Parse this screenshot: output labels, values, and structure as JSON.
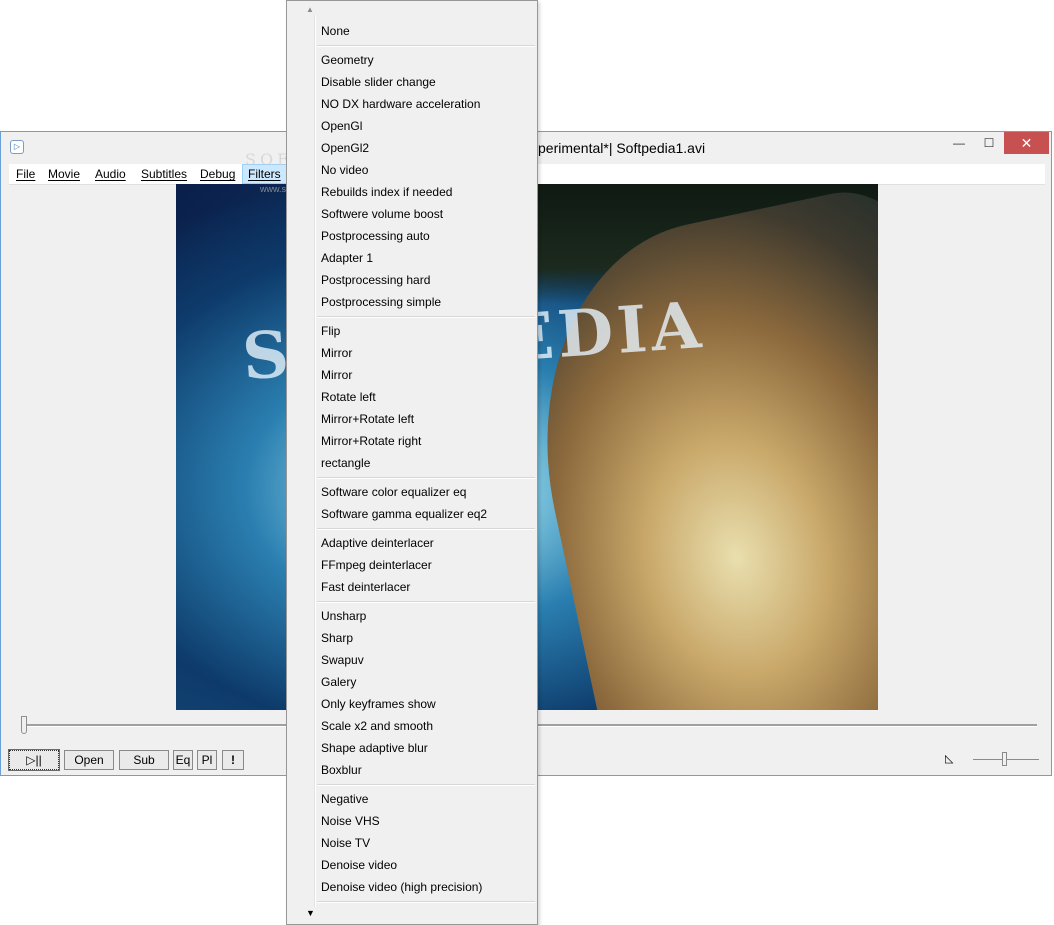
{
  "window": {
    "title": "perimental*| Softpedia1.avi",
    "min_glyph": "—",
    "max_glyph": "☐",
    "close_glyph": "✕",
    "app_icon_glyph": "▷"
  },
  "menubar": {
    "items": [
      {
        "label": "File"
      },
      {
        "label": "Movie"
      },
      {
        "label": "Audio"
      },
      {
        "label": "Subtitles"
      },
      {
        "label": "Debug"
      },
      {
        "label": "Filters"
      }
    ]
  },
  "video": {
    "overlay_text": "SOFTPEDIA",
    "watermark": "SOFTPEDIA",
    "watermark_url": "www.softpedia.com"
  },
  "controls": {
    "play_label": "▷||",
    "open_label": "Open",
    "sub_label": "Sub",
    "eq_label": "Eq",
    "pl_label": "Pl",
    "warn_label": "!",
    "volume_icon_glyph": "◺"
  },
  "filters_menu": {
    "scroll_up_glyph": "▲",
    "scroll_down_glyph": "▼",
    "groups": [
      [
        "None"
      ],
      [
        "Geometry",
        "Disable slider change",
        "NO DX hardware acceleration",
        "OpenGl",
        "OpenGl2",
        "No video",
        "Rebuilds index if needed",
        "Softwere volume boost",
        "Postprocessing auto",
        "Adapter 1",
        "Postprocessing hard",
        "Postprocessing simple"
      ],
      [
        "Flip",
        "Mirror",
        "Mirror",
        "Rotate left",
        "Mirror+Rotate left",
        "Mirror+Rotate right",
        "rectangle"
      ],
      [
        "Software color equalizer eq",
        "Software gamma equalizer eq2"
      ],
      [
        "Adaptive deinterlacer",
        "FFmpeg deinterlacer",
        "Fast deinterlacer"
      ],
      [
        "Unsharp",
        "Sharp",
        "Swapuv",
        "Galery",
        "Only keyframes show",
        "Scale x2 and smooth",
        "Shape adaptive blur",
        "Boxblur"
      ],
      [
        "Negative",
        "Noise VHS",
        "Noise TV",
        "Denoise video",
        "Denoise video (high precision)"
      ]
    ]
  }
}
